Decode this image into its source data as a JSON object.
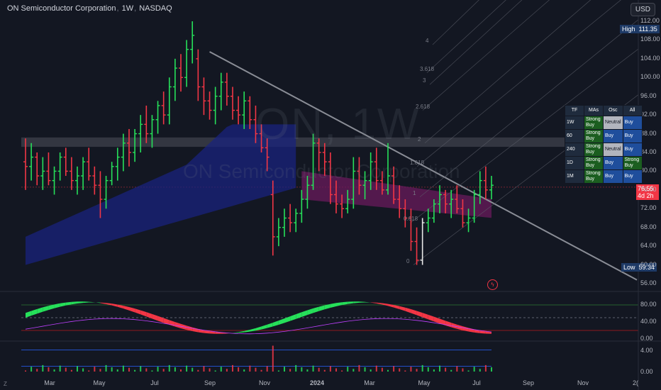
{
  "header": {
    "symbol": "ON Semiconductor Corporation",
    "interval": "1W",
    "exchange": "NASDAQ",
    "currency": "USD"
  },
  "watermark": {
    "ticker": "ON, 1W",
    "company": "ON Semiconductor Corporation"
  },
  "price_tags": {
    "high_label": "High",
    "high_value": "111.35",
    "low_label": "Low",
    "low_value": "59.34",
    "last_price": "76.55",
    "countdown": "4d 2h"
  },
  "fib_levels": [
    "4",
    "3.618",
    "3",
    "2.618",
    "2",
    "1.618",
    "1",
    "0.618",
    "0"
  ],
  "colors": {
    "up": "#26e05a",
    "down": "#f23645",
    "background": "#131722",
    "trendline": "#8a8d96",
    "band_blue": "#1a237e",
    "band_purple": "#6a1b5c",
    "fib": "#5d606b"
  },
  "signal_table": {
    "headers": [
      "TF",
      "MAs",
      "Osc",
      "All"
    ],
    "rows": [
      {
        "tf": "1W",
        "mas": "Strong Buy",
        "osc": "Neutral",
        "all": "Buy"
      },
      {
        "tf": "60",
        "mas": "Strong Buy",
        "osc": "Buy",
        "all": "Buy"
      },
      {
        "tf": "240",
        "mas": "Strong Buy",
        "osc": "Neutral",
        "all": "Buy"
      },
      {
        "tf": "1D",
        "mas": "Strong Buy",
        "osc": "Buy",
        "all": "Strong Buy"
      },
      {
        "tf": "1M",
        "mas": "Strong Buy",
        "osc": "Buy",
        "all": "Buy"
      }
    ]
  },
  "chart_data": [
    {
      "type": "ohlc",
      "y_axis": {
        "range": [
          56,
          112
        ],
        "ticks": [
          "112.00",
          "108.00",
          "104.00",
          "100.00",
          "96.00",
          "92.00",
          "88.00",
          "84.00",
          "80.00",
          "76.00",
          "72.00",
          "68.00",
          "64.00",
          "60.00",
          "56.00"
        ]
      },
      "x_axis": {
        "labels": [
          "Mar",
          "May",
          "Jul",
          "Sep",
          "Nov",
          "2024",
          "Mar",
          "May",
          "Jul",
          "Sep",
          "Nov",
          "2("
        ]
      },
      "grid": false,
      "bars": [
        [
          82,
          87,
          76,
          81
        ],
        [
          81,
          86,
          78,
          83
        ],
        [
          83,
          84,
          77,
          79
        ],
        [
          79,
          83,
          76,
          80
        ],
        [
          80,
          84,
          77,
          78
        ],
        [
          78,
          81,
          75,
          80
        ],
        [
          80,
          84,
          78,
          83
        ],
        [
          83,
          85,
          79,
          80
        ],
        [
          80,
          83,
          76,
          78
        ],
        [
          78,
          81,
          75,
          79
        ],
        [
          79,
          83,
          76,
          82
        ],
        [
          82,
          85,
          78,
          79
        ],
        [
          79,
          81,
          75,
          77
        ],
        [
          77,
          80,
          70,
          74
        ],
        [
          74,
          79,
          72,
          78
        ],
        [
          78,
          82,
          77,
          81
        ],
        [
          81,
          85,
          78,
          83
        ],
        [
          83,
          88,
          80,
          86
        ],
        [
          86,
          89,
          81,
          84
        ],
        [
          84,
          89,
          82,
          88
        ],
        [
          88,
          92,
          84,
          90
        ],
        [
          90,
          94,
          86,
          88
        ],
        [
          88,
          92,
          85,
          91
        ],
        [
          91,
          95,
          88,
          94
        ],
        [
          94,
          97,
          90,
          92
        ],
        [
          92,
          100,
          90,
          98
        ],
        [
          98,
          104,
          95,
          102
        ],
        [
          102,
          105,
          97,
          100
        ],
        [
          100,
          108,
          98,
          106
        ],
        [
          106,
          112,
          103,
          109
        ],
        [
          104,
          106,
          95,
          98
        ],
        [
          98,
          100,
          92,
          95
        ],
        [
          95,
          97,
          91,
          93
        ],
        [
          93,
          98,
          90,
          96
        ],
        [
          96,
          101,
          93,
          99
        ],
        [
          99,
          101,
          94,
          96
        ],
        [
          96,
          98,
          91,
          93
        ],
        [
          93,
          96,
          90,
          92
        ],
        [
          92,
          97,
          89,
          95
        ],
        [
          95,
          96,
          89,
          91
        ],
        [
          91,
          94,
          86,
          88
        ],
        [
          88,
          90,
          84,
          85
        ],
        [
          85,
          87,
          80,
          83
        ],
        [
          75,
          78,
          62,
          66
        ],
        [
          66,
          70,
          64,
          68
        ],
        [
          68,
          72,
          66,
          70
        ],
        [
          70,
          73,
          67,
          69
        ],
        [
          69,
          72,
          67,
          71
        ],
        [
          71,
          76,
          69,
          74
        ],
        [
          74,
          79,
          72,
          77
        ],
        [
          77,
          88,
          76,
          86
        ],
        [
          86,
          87,
          80,
          84
        ],
        [
          84,
          86,
          79,
          82
        ],
        [
          82,
          84,
          73,
          75
        ],
        [
          75,
          78,
          71,
          73
        ],
        [
          73,
          75,
          70,
          72
        ],
        [
          72,
          76,
          71,
          74
        ],
        [
          74,
          83,
          72,
          80
        ],
        [
          80,
          83,
          75,
          77
        ],
        [
          77,
          80,
          74,
          78
        ],
        [
          78,
          84,
          76,
          82
        ],
        [
          82,
          85,
          76,
          78
        ],
        [
          78,
          80,
          75,
          76
        ],
        [
          76,
          86,
          75,
          79
        ],
        [
          79,
          81,
          73,
          74
        ],
        [
          74,
          77,
          70,
          72
        ],
        [
          72,
          74,
          68,
          70
        ],
        [
          70,
          72,
          63,
          65
        ],
        [
          65,
          68,
          60,
          61
        ],
        [
          61,
          70,
          60,
          69
        ],
        [
          69,
          72,
          67,
          70
        ],
        [
          70,
          74,
          69,
          73
        ],
        [
          73,
          77,
          71,
          75
        ],
        [
          75,
          76,
          71,
          73
        ],
        [
          73,
          76,
          70,
          74
        ],
        [
          74,
          77,
          71,
          72
        ],
        [
          72,
          74,
          68,
          69
        ],
        [
          69,
          72,
          67,
          70
        ],
        [
          70,
          76,
          69,
          75
        ],
        [
          75,
          80,
          73,
          78
        ],
        [
          78,
          81,
          74,
          76
        ],
        [
          76,
          79,
          74,
          77
        ]
      ]
    },
    {
      "type": "oscillator",
      "y_axis": {
        "range": [
          0,
          100
        ],
        "ticks": [
          "80.00",
          "40.00",
          "0.00"
        ]
      },
      "levels": [
        80,
        50,
        20
      ]
    },
    {
      "type": "histogram",
      "y_axis": {
        "range": [
          0,
          50
        ],
        "ticks": [
          "4.00",
          "0.00"
        ]
      },
      "levels": [
        40,
        10
      ]
    }
  ]
}
